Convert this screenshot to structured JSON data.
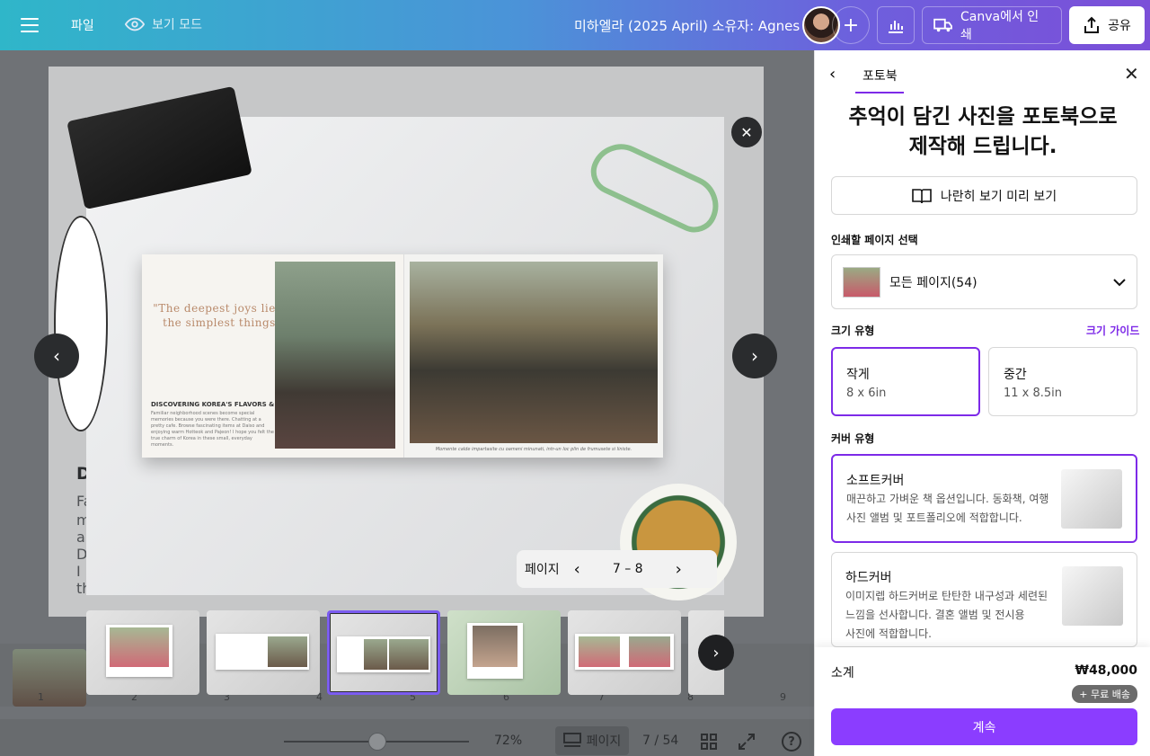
{
  "topbar": {
    "file_label": "파일",
    "view_mode_label": "보기 모드",
    "doc_title": "미하엘라 (2025 April) 소유자: Agnes",
    "add_label": "+",
    "print_label": "Canva에서 인쇄",
    "share_label": "공유"
  },
  "canvas": {
    "page_fragment_heading": "D",
    "page_fragment_lines": [
      "Fa",
      "m",
      "a",
      "D",
      "I",
      "th"
    ]
  },
  "modal": {
    "quote": "\"The deepest joys lie in the simplest things\"",
    "book_heading": "DISCOVERING KOREA'S FLAVORS & CHARMS",
    "book_body": "Familiar neighborhood scenes become special memories because you were there. Chatting at a pretty cafe. Browse fascinating items at Daiso and enjoying warm Hotteok and Pajeon! I hope you felt the true charm of Korea in these small, everyday moments.",
    "book_caption": "Momente calde impartasite cu oameni minunati, intr-un loc plin de frumusete si liniste.",
    "page_label": "페이지",
    "page_range": "7 – 8"
  },
  "strip": {
    "labels": [
      "1",
      "2",
      "3",
      "4",
      "5",
      "6",
      "7",
      "8",
      "9"
    ]
  },
  "bottom": {
    "zoom": "72%",
    "pages_label": "페이지",
    "page_counter": "7 / 54"
  },
  "panel": {
    "tab": "포토북",
    "headline_line1": "추억이 담긴 사진을 포토북으로",
    "headline_line2": "제작해 드립니다.",
    "preview_button": "나란히 보기 미리 보기",
    "select_pages_label": "인쇄할 페이지 선택",
    "select_pages_value": "모든 페이지(54)",
    "size_label": "크기 유형",
    "size_guide": "크기 가이드",
    "sizes": [
      {
        "name": "작게",
        "dim": "8 x 6in"
      },
      {
        "name": "중간",
        "dim": "11 x 8.5in"
      }
    ],
    "cover_label": "커버 유형",
    "covers": [
      {
        "name": "소프트커버",
        "desc_line1": "매끈하고 가벼운 책 옵션입니다. 동화책, 여행",
        "desc_line2": "사진 앨범 및 포트폴리오에 적합합니다."
      },
      {
        "name": "하드커버",
        "desc_line1": "이미지렙 하드커버로 탄탄한 내구성과 세련된",
        "desc_line2": "느낌을 선사합니다. 결혼 앨범 및 전시용",
        "desc_line3": "사진에 적합합니다."
      }
    ],
    "subtotal_label": "소계",
    "subtotal_value": "₩48,000",
    "shipping_badge": "+ 무료 배송",
    "continue_button": "계속"
  },
  "colors": {
    "accent": "#7d2ae8",
    "continue": "#8b3dff"
  }
}
